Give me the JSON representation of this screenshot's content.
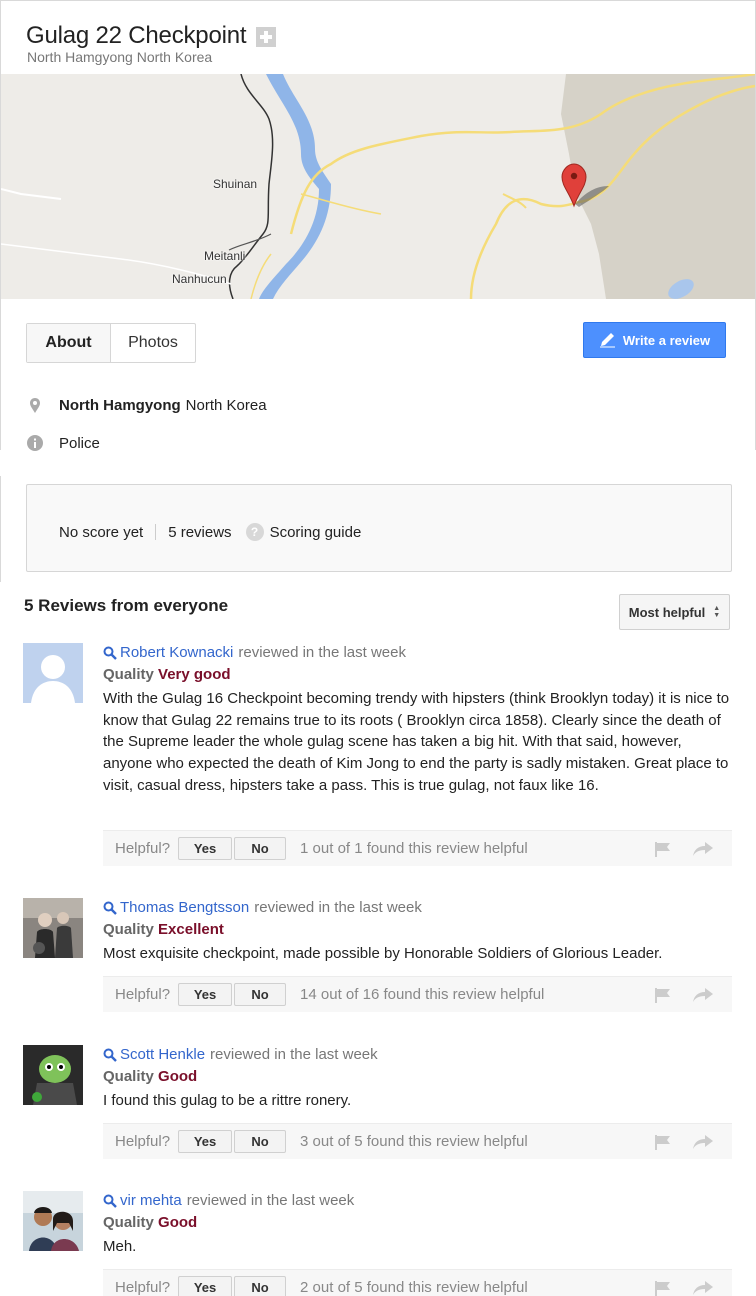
{
  "place": {
    "title": "Gulag 22 Checkpoint",
    "subtitle": "North Hamgyong North Korea"
  },
  "map": {
    "labels": [
      "Shuinan",
      "Meitanli",
      "Nanhucun"
    ]
  },
  "tabs": [
    {
      "label": "About",
      "active": true
    },
    {
      "label": "Photos",
      "active": false
    }
  ],
  "write_review_label": "Write a review",
  "info": {
    "location_bold": "North Hamgyong",
    "location_rest": "North Korea",
    "category": "Police"
  },
  "score": {
    "no_score": "No score yet",
    "reviews_count": "5 reviews",
    "scoring_guide": "Scoring guide"
  },
  "reviews_header": {
    "title": "5 Reviews from everyone",
    "sort_label": "Most helpful"
  },
  "helpful_labels": {
    "prompt": "Helpful?",
    "yes": "Yes",
    "no": "No"
  },
  "reviews": [
    {
      "author": "Robert Kownacki",
      "when": "reviewed in the last week",
      "quality_label": "Quality",
      "quality_value": "Very good",
      "text": "With the Gulag 16 Checkpoint becoming trendy with hipsters (think Brooklyn today) it is nice to know that Gulag 22 remains true to its roots ( Brooklyn circa 1858). Clearly since the death of the Supreme leader the whole gulag scene has taken a big hit. With that said, however, anyone who expected the death of Kim Jong to end the party is sadly mistaken. Great place to visit, casual dress, hipsters take a pass. This is true gulag, not faux like 16.",
      "helpful_count": "1 out of 1 found this review helpful"
    },
    {
      "author": "Thomas Bengtsson",
      "when": "reviewed in the last week",
      "quality_label": "Quality",
      "quality_value": "Excellent",
      "text": "Most exquisite checkpoint, made possible by Honorable Soldiers of Glorious Leader.",
      "helpful_count": "14 out of 16 found this review helpful"
    },
    {
      "author": "Scott Henkle",
      "when": "reviewed in the last week",
      "quality_label": "Quality",
      "quality_value": "Good",
      "text": "I found this gulag to be a rittre ronery.",
      "helpful_count": "3 out of 5 found this review helpful"
    },
    {
      "author": "vir mehta",
      "when": "reviewed in the last week",
      "quality_label": "Quality",
      "quality_value": "Good",
      "text": "Meh.",
      "helpful_count": "2 out of 5 found this review helpful"
    }
  ],
  "colors": {
    "link_blue": "#3366cc",
    "quality_value": "#7a0f2a",
    "write_button": "#4d90fe",
    "map_river": "#8fb5e8",
    "map_road": "#f5dc78",
    "map_pin": "#e0403a"
  }
}
